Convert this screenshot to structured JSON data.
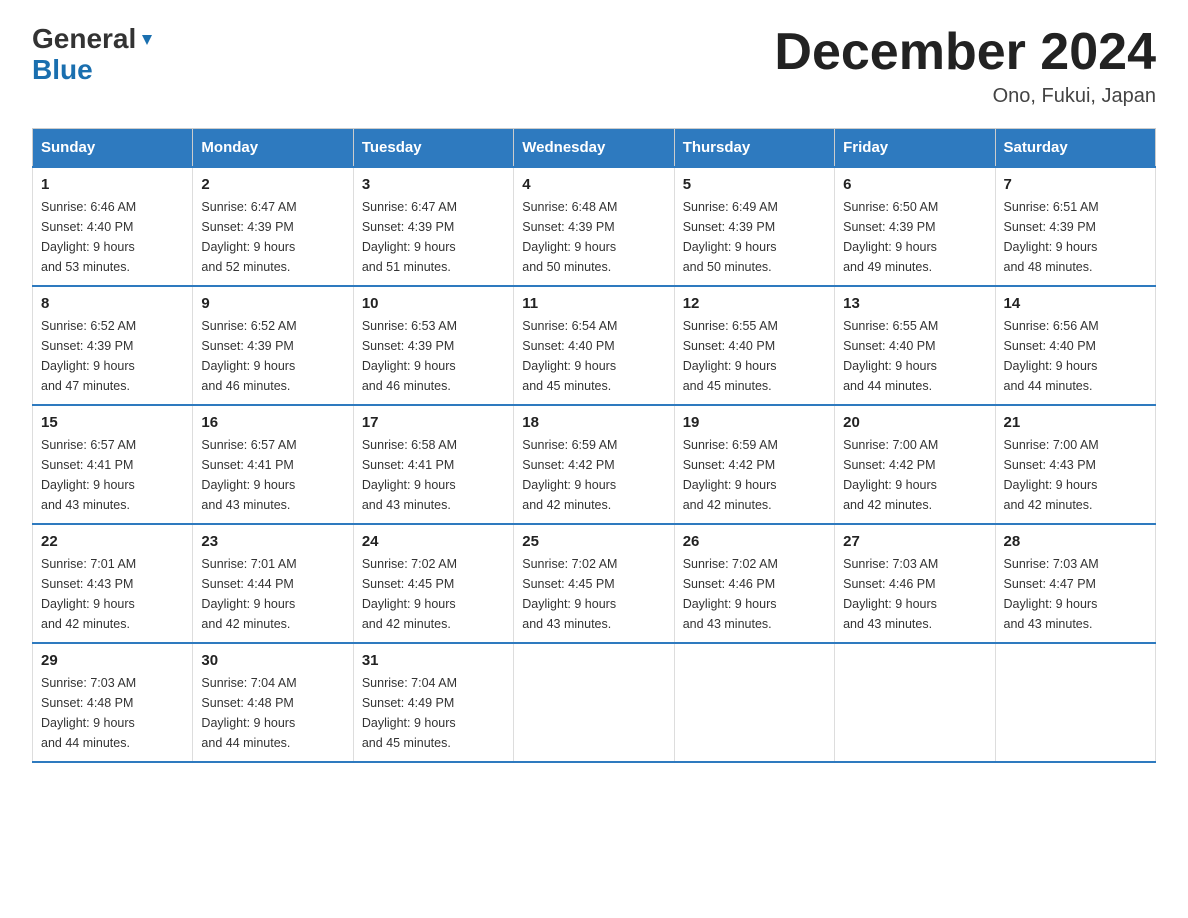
{
  "header": {
    "logo_general": "General",
    "logo_blue": "Blue",
    "title": "December 2024",
    "location": "Ono, Fukui, Japan"
  },
  "calendar": {
    "days_of_week": [
      "Sunday",
      "Monday",
      "Tuesday",
      "Wednesday",
      "Thursday",
      "Friday",
      "Saturday"
    ],
    "weeks": [
      [
        {
          "day": "1",
          "sunrise": "6:46 AM",
          "sunset": "4:40 PM",
          "daylight": "9 hours and 53 minutes."
        },
        {
          "day": "2",
          "sunrise": "6:47 AM",
          "sunset": "4:39 PM",
          "daylight": "9 hours and 52 minutes."
        },
        {
          "day": "3",
          "sunrise": "6:47 AM",
          "sunset": "4:39 PM",
          "daylight": "9 hours and 51 minutes."
        },
        {
          "day": "4",
          "sunrise": "6:48 AM",
          "sunset": "4:39 PM",
          "daylight": "9 hours and 50 minutes."
        },
        {
          "day": "5",
          "sunrise": "6:49 AM",
          "sunset": "4:39 PM",
          "daylight": "9 hours and 50 minutes."
        },
        {
          "day": "6",
          "sunrise": "6:50 AM",
          "sunset": "4:39 PM",
          "daylight": "9 hours and 49 minutes."
        },
        {
          "day": "7",
          "sunrise": "6:51 AM",
          "sunset": "4:39 PM",
          "daylight": "9 hours and 48 minutes."
        }
      ],
      [
        {
          "day": "8",
          "sunrise": "6:52 AM",
          "sunset": "4:39 PM",
          "daylight": "9 hours and 47 minutes."
        },
        {
          "day": "9",
          "sunrise": "6:52 AM",
          "sunset": "4:39 PM",
          "daylight": "9 hours and 46 minutes."
        },
        {
          "day": "10",
          "sunrise": "6:53 AM",
          "sunset": "4:39 PM",
          "daylight": "9 hours and 46 minutes."
        },
        {
          "day": "11",
          "sunrise": "6:54 AM",
          "sunset": "4:40 PM",
          "daylight": "9 hours and 45 minutes."
        },
        {
          "day": "12",
          "sunrise": "6:55 AM",
          "sunset": "4:40 PM",
          "daylight": "9 hours and 45 minutes."
        },
        {
          "day": "13",
          "sunrise": "6:55 AM",
          "sunset": "4:40 PM",
          "daylight": "9 hours and 44 minutes."
        },
        {
          "day": "14",
          "sunrise": "6:56 AM",
          "sunset": "4:40 PM",
          "daylight": "9 hours and 44 minutes."
        }
      ],
      [
        {
          "day": "15",
          "sunrise": "6:57 AM",
          "sunset": "4:41 PM",
          "daylight": "9 hours and 43 minutes."
        },
        {
          "day": "16",
          "sunrise": "6:57 AM",
          "sunset": "4:41 PM",
          "daylight": "9 hours and 43 minutes."
        },
        {
          "day": "17",
          "sunrise": "6:58 AM",
          "sunset": "4:41 PM",
          "daylight": "9 hours and 43 minutes."
        },
        {
          "day": "18",
          "sunrise": "6:59 AM",
          "sunset": "4:42 PM",
          "daylight": "9 hours and 42 minutes."
        },
        {
          "day": "19",
          "sunrise": "6:59 AM",
          "sunset": "4:42 PM",
          "daylight": "9 hours and 42 minutes."
        },
        {
          "day": "20",
          "sunrise": "7:00 AM",
          "sunset": "4:42 PM",
          "daylight": "9 hours and 42 minutes."
        },
        {
          "day": "21",
          "sunrise": "7:00 AM",
          "sunset": "4:43 PM",
          "daylight": "9 hours and 42 minutes."
        }
      ],
      [
        {
          "day": "22",
          "sunrise": "7:01 AM",
          "sunset": "4:43 PM",
          "daylight": "9 hours and 42 minutes."
        },
        {
          "day": "23",
          "sunrise": "7:01 AM",
          "sunset": "4:44 PM",
          "daylight": "9 hours and 42 minutes."
        },
        {
          "day": "24",
          "sunrise": "7:02 AM",
          "sunset": "4:45 PM",
          "daylight": "9 hours and 42 minutes."
        },
        {
          "day": "25",
          "sunrise": "7:02 AM",
          "sunset": "4:45 PM",
          "daylight": "9 hours and 43 minutes."
        },
        {
          "day": "26",
          "sunrise": "7:02 AM",
          "sunset": "4:46 PM",
          "daylight": "9 hours and 43 minutes."
        },
        {
          "day": "27",
          "sunrise": "7:03 AM",
          "sunset": "4:46 PM",
          "daylight": "9 hours and 43 minutes."
        },
        {
          "day": "28",
          "sunrise": "7:03 AM",
          "sunset": "4:47 PM",
          "daylight": "9 hours and 43 minutes."
        }
      ],
      [
        {
          "day": "29",
          "sunrise": "7:03 AM",
          "sunset": "4:48 PM",
          "daylight": "9 hours and 44 minutes."
        },
        {
          "day": "30",
          "sunrise": "7:04 AM",
          "sunset": "4:48 PM",
          "daylight": "9 hours and 44 minutes."
        },
        {
          "day": "31",
          "sunrise": "7:04 AM",
          "sunset": "4:49 PM",
          "daylight": "9 hours and 45 minutes."
        },
        {
          "day": "",
          "sunrise": "",
          "sunset": "",
          "daylight": ""
        },
        {
          "day": "",
          "sunrise": "",
          "sunset": "",
          "daylight": ""
        },
        {
          "day": "",
          "sunrise": "",
          "sunset": "",
          "daylight": ""
        },
        {
          "day": "",
          "sunrise": "",
          "sunset": "",
          "daylight": ""
        }
      ]
    ],
    "labels": {
      "sunrise": "Sunrise: ",
      "sunset": "Sunset: ",
      "daylight": "Daylight: "
    }
  }
}
